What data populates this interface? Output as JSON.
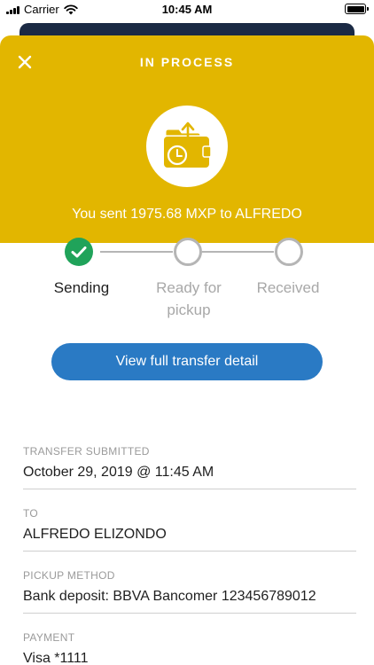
{
  "status_bar": {
    "carrier": "Carrier",
    "time": "10:45 AM"
  },
  "header": {
    "title": "IN PROCESS",
    "message": "You sent 1975.68 MXP to ALFREDO",
    "background_color": "#e2b600"
  },
  "stepper": {
    "steps": [
      {
        "label": "Sending",
        "state": "complete"
      },
      {
        "label": "Ready for pickup",
        "state": "pending"
      },
      {
        "label": "Received",
        "state": "pending"
      }
    ]
  },
  "cta": {
    "label": "View full transfer detail",
    "color": "#2a7ac4"
  },
  "details": [
    {
      "label": "TRANSFER SUBMITTED",
      "value": "October 29, 2019 @ 11:45 AM"
    },
    {
      "label": "TO",
      "value": "ALFREDO ELIZONDO"
    },
    {
      "label": "PICKUP METHOD",
      "value": "Bank deposit: BBVA Bancomer 123456789012"
    },
    {
      "label": "PAYMENT",
      "value": "Visa *1111"
    }
  ],
  "icons": {
    "close": "close-icon",
    "transfer": "wallet-clock-icon",
    "check": "check-icon"
  }
}
